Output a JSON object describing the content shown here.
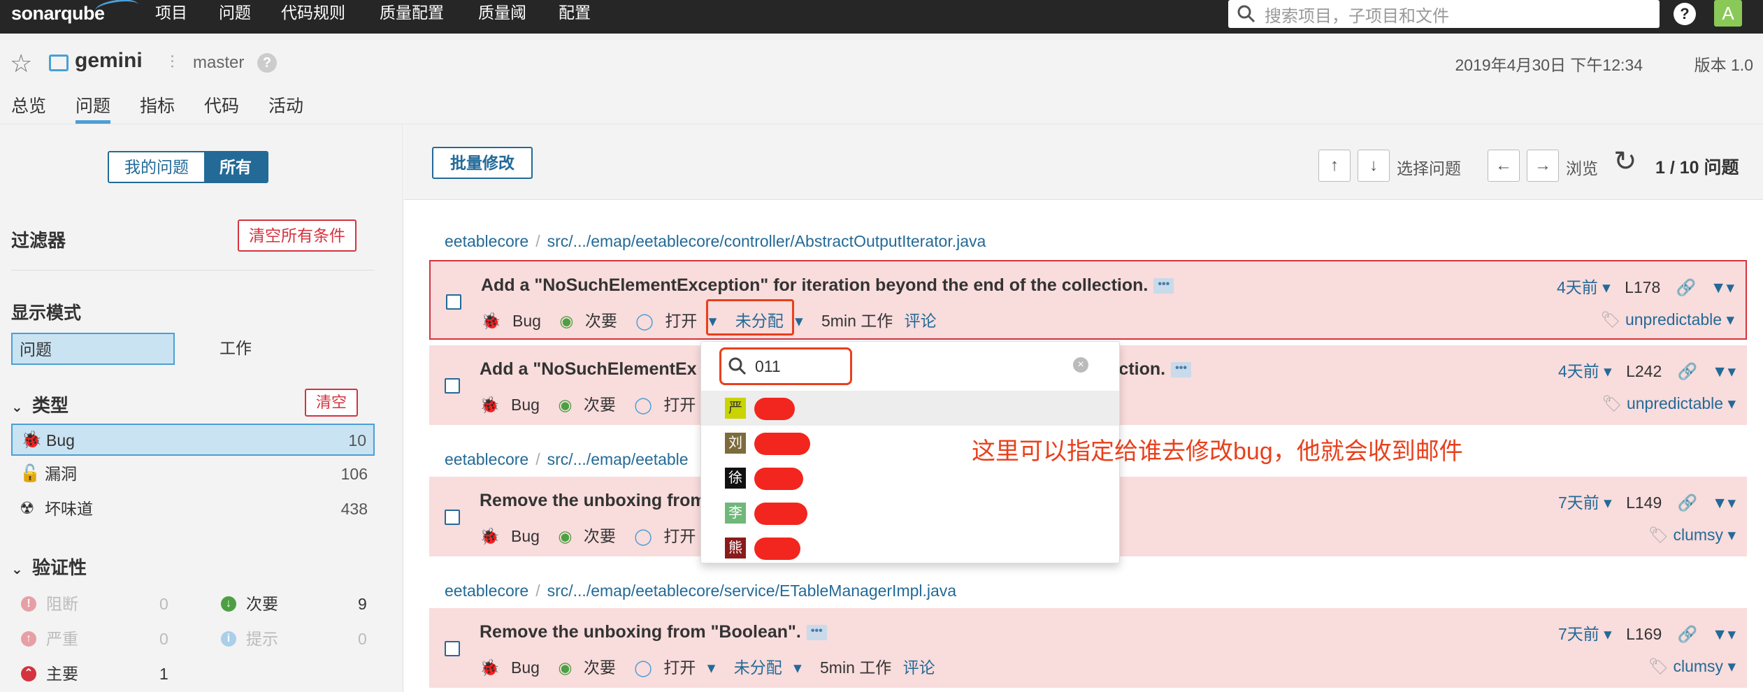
{
  "app": {
    "logo": "sonarqube"
  },
  "topnav": {
    "items": [
      "项目",
      "问题",
      "代码规则",
      "质量配置",
      "质量阈",
      "配置"
    ],
    "search_placeholder": "搜索项目，子项目和文件",
    "help_label": "?",
    "user_initial": "A"
  },
  "project": {
    "name": "gemini",
    "branch": "master",
    "branch_help": "?",
    "date": "2019年4月30日 下午12:34",
    "version": "版本 1.0",
    "tabs": [
      "总览",
      "问题",
      "指标",
      "代码",
      "活动"
    ]
  },
  "sidebar": {
    "my_issues": "我的问题",
    "all": "所有",
    "filters_title": "过滤器",
    "clear_all": "清空所有条件",
    "display_mode_title": "显示模式",
    "mode_issues": "问题",
    "mode_effort": "工作",
    "type_title": "类型",
    "type_clear": "清空",
    "types": [
      {
        "label": "Bug",
        "count": "10",
        "icon": "bug-icon"
      },
      {
        "label": "漏洞",
        "count": "106",
        "icon": "lock-icon"
      },
      {
        "label": "坏味道",
        "count": "438",
        "icon": "radiation-icon"
      }
    ],
    "severity_title": "验证性",
    "severities": [
      {
        "label": "阻断",
        "count": "0",
        "color": "#d4333f"
      },
      {
        "label": "次要",
        "count": "9",
        "color": "#4c9f43"
      },
      {
        "label": "严重",
        "count": "0",
        "color": "#d4333f"
      },
      {
        "label": "提示",
        "count": "0",
        "color": "#4b9fd5"
      },
      {
        "label": "主要",
        "count": "1",
        "color": "#d4333f"
      }
    ]
  },
  "toolbar": {
    "bulk_change": "批量修改",
    "up": "↑",
    "down": "↓",
    "select_label": "选择问题",
    "left": "←",
    "right": "→",
    "browse_label": "浏览",
    "pager": "1 / 10 问题"
  },
  "components": [
    {
      "project": "eetablecore",
      "path": "src/.../emap/eetablecore/controller/AbstractOutputIterator.java"
    },
    {
      "project": "eetablecore",
      "path": "src/.../emap/eetable"
    },
    {
      "project": "eetablecore",
      "path": "src/.../emap/eetablecore/service/ETableManagerImpl.java"
    }
  ],
  "issues": [
    {
      "message": "Add a \"NoSuchElementException\" for iteration beyond the end of the collection.",
      "type": "Bug",
      "severity": "次要",
      "status": "打开",
      "assignee": "未分配",
      "effort": "5min 工作",
      "comment": "评论",
      "age": "4天前",
      "line": "L178",
      "tag": "unpredictable"
    },
    {
      "message_left": "Add a \"NoSuchElementEx",
      "message_right": "ection.",
      "type": "Bug",
      "severity": "次要",
      "status": "打开",
      "age": "4天前",
      "line": "L242",
      "tag": "unpredictable"
    },
    {
      "message": "Remove the unboxing from",
      "type": "Bug",
      "severity": "次要",
      "status": "打开",
      "age": "7天前",
      "line": "L149",
      "tag": "clumsy"
    },
    {
      "message": "Remove the unboxing from \"Boolean\".",
      "type": "Bug",
      "severity": "次要",
      "status": "打开",
      "assignee": "未分配",
      "effort": "5min 工作",
      "comment": "评论",
      "age": "7天前",
      "line": "L169",
      "tag": "clumsy"
    }
  ],
  "assignee_dropdown": {
    "query": "011",
    "clear": "×",
    "users": [
      {
        "initial": "严",
        "color": "#c9d400"
      },
      {
        "initial": "刘",
        "color": "#7d6b3c"
      },
      {
        "initial": "徐",
        "color": "#111111"
      },
      {
        "initial": "李",
        "color": "#6fb87a"
      },
      {
        "initial": "熊",
        "color": "#8a1b1b"
      }
    ]
  },
  "annotation": "这里可以指定给谁去修改bug，他就会收到邮件",
  "misc": {
    "more": "•••",
    "caret": "▾",
    "sep": "/"
  }
}
